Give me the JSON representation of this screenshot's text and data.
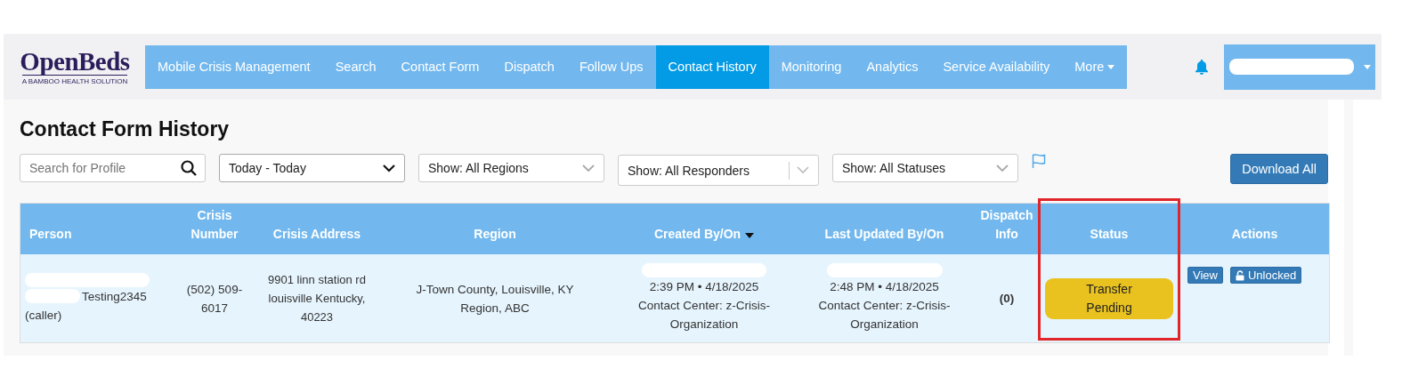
{
  "logo": {
    "name": "OpenBeds",
    "tagline": "A BAMBOO HEALTH SOLUTION"
  },
  "nav": [
    {
      "label": "Mobile Crisis Management",
      "selected": false
    },
    {
      "label": "Search",
      "selected": false
    },
    {
      "label": "Contact Form",
      "selected": false
    },
    {
      "label": "Dispatch",
      "selected": false
    },
    {
      "label": "Follow Ups",
      "selected": false
    },
    {
      "label": "Contact History",
      "selected": true
    },
    {
      "label": "Monitoring",
      "selected": false
    },
    {
      "label": "Analytics",
      "selected": false
    },
    {
      "label": "Service Availability",
      "selected": false
    },
    {
      "label": "More",
      "selected": false
    }
  ],
  "page_title": "Contact Form History",
  "filters": {
    "search_placeholder": "Search for Profile",
    "date_range": "Today - Today",
    "regions": "Show: All Regions",
    "responders": "Show: All Responders",
    "statuses": "Show: All Statuses"
  },
  "download_button": "Download All",
  "table": {
    "columns": [
      {
        "label": "Person",
        "sorted": false,
        "highlighted": false
      },
      {
        "label": "Crisis Number",
        "sorted": false,
        "highlighted": false
      },
      {
        "label": "Crisis Address",
        "sorted": false,
        "highlighted": false
      },
      {
        "label": "Region",
        "sorted": false,
        "highlighted": false
      },
      {
        "label": "Created By/On",
        "sorted": true,
        "highlighted": false
      },
      {
        "label": "Last Updated By/On",
        "sorted": false,
        "highlighted": false
      },
      {
        "label": "Dispatch Info",
        "sorted": false,
        "highlighted": false
      },
      {
        "label": "Status",
        "sorted": false,
        "highlighted": true
      },
      {
        "label": "Actions",
        "sorted": false,
        "highlighted": false
      }
    ],
    "rows": [
      {
        "person_note": "Testing2345",
        "person_role": "(caller)",
        "crisis_number": "(502) 509-6017",
        "crisis_address": "9901 linn station rd louisville Kentucky, 40223",
        "region": "J-Town County, Louisville, KY Region, ABC",
        "created_time": "2:39 PM • 4/18/2025",
        "created_org": "Contact Center: z-Crisis-Organization",
        "updated_time": "2:48 PM • 4/18/2025",
        "updated_org": "Contact Center: z-Crisis-Organization",
        "dispatch_info": "(0)",
        "status": {
          "label": "Transfer Pending",
          "kind": "pending"
        },
        "actions": {
          "view": "View",
          "lock": "Unlocked",
          "locked": false
        }
      }
    ]
  }
}
